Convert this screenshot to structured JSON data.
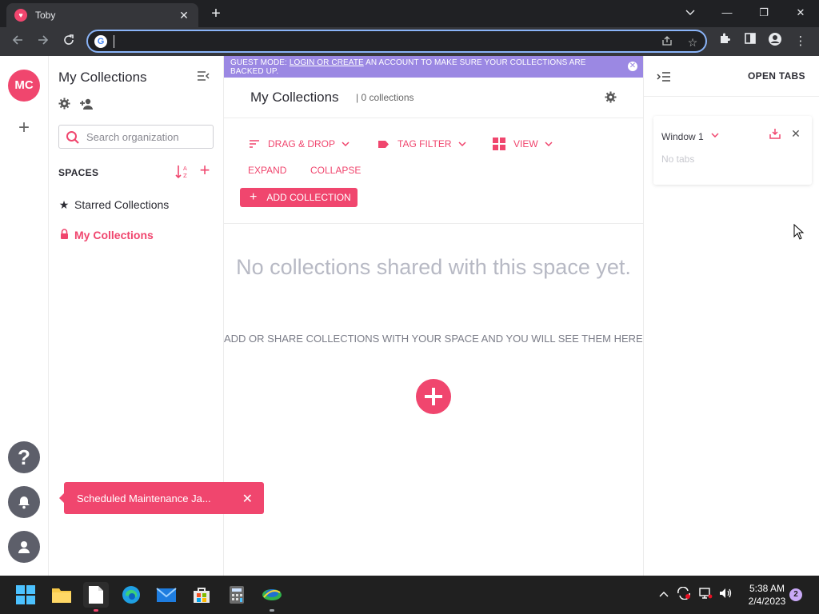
{
  "browser": {
    "tab_title": "Toby",
    "tab_close": "✕",
    "new_tab": "+",
    "address_value": "",
    "window_controls": {
      "minimize": "—",
      "restore": "❐",
      "close": "✕"
    }
  },
  "rail": {
    "avatar_initials": "MC",
    "add_label": "+"
  },
  "sidebar": {
    "title": "My Collections",
    "search_placeholder": "Search organization",
    "spaces_label": "SPACES",
    "items": [
      {
        "label": "Starred Collections",
        "icon": "star-icon"
      },
      {
        "label": "My Collections",
        "icon": "lock-icon",
        "active": true
      }
    ]
  },
  "banner": {
    "prefix": "GUEST MODE: ",
    "link": "LOGIN OR CREATE",
    "suffix": " AN ACCOUNT TO MAKE SURE YOUR COLLECTIONS ARE BACKED UP."
  },
  "main": {
    "title": "My Collections",
    "count": "| 0 collections",
    "controls": {
      "drag_drop": "DRAG & DROP",
      "tag_filter": "TAG FILTER",
      "view": "VIEW",
      "expand": "EXPAND",
      "collapse": "COLLAPSE",
      "add_collection": "ADD COLLECTION"
    },
    "empty_title": "No collections shared with this space yet.",
    "empty_subtitle": "ADD OR SHARE COLLECTIONS WITH YOUR SPACE AND YOU WILL SEE THEM HERE."
  },
  "right_panel": {
    "title": "OPEN TABS",
    "window_name": "Window 1",
    "no_tabs": "No tabs"
  },
  "toast": {
    "text": "Scheduled Maintenance Ja..."
  },
  "taskbar": {
    "time": "5:38 AM",
    "date": "2/4/2023",
    "notification_count": "2"
  },
  "colors": {
    "accent": "#f0466e",
    "banner": "#9b88e3",
    "rail_button": "#5d5f6a"
  }
}
